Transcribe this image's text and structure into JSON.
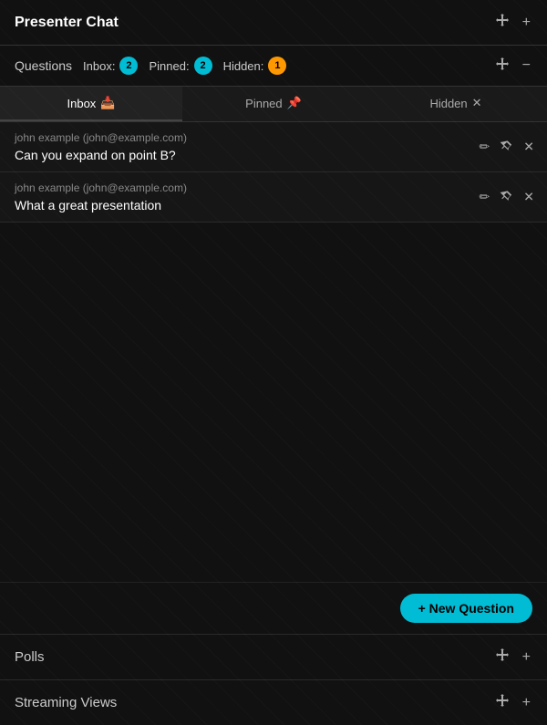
{
  "header": {
    "title": "Presenter Chat",
    "move_icon": "✛",
    "add_icon": "+"
  },
  "questions_bar": {
    "label": "Questions",
    "inbox_label": "Inbox:",
    "inbox_count": "2",
    "pinned_label": "Pinned:",
    "pinned_count": "2",
    "hidden_label": "Hidden:",
    "hidden_count": "1",
    "move_icon": "✛",
    "minus_icon": "−"
  },
  "tabs": [
    {
      "id": "inbox",
      "label": "Inbox",
      "icon": "⬇",
      "active": true
    },
    {
      "id": "pinned",
      "label": "Pinned",
      "icon": "📌",
      "active": false
    },
    {
      "id": "hidden",
      "label": "Hidden",
      "icon": "✕",
      "active": false
    }
  ],
  "questions": [
    {
      "author": "john example (john@example.com)",
      "text": "Can you expand on point B?"
    },
    {
      "author": "john example (john@example.com)",
      "text": "What a great presentation"
    }
  ],
  "new_question_btn": "+ New Question",
  "polls": {
    "label": "Polls",
    "move_icon": "✛",
    "add_icon": "+"
  },
  "streaming_views": {
    "label": "Streaming Views",
    "move_icon": "✛",
    "add_icon": "+"
  }
}
